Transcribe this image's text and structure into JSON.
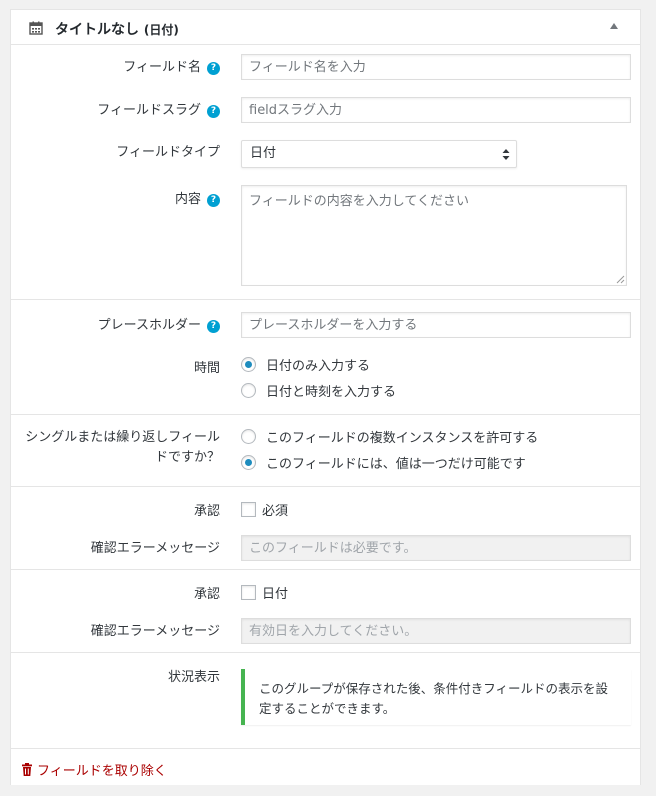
{
  "header": {
    "title": "タイトルなし",
    "type_label": "(日付)",
    "icon": "calendar-icon",
    "toggle_icon": "triangle-up-icon"
  },
  "fields": {
    "field_name": {
      "label": "フィールド名",
      "placeholder": "フィールド名を入力"
    },
    "field_slug": {
      "label": "フィールドスラグ",
      "placeholder": "fieldスラグ入力"
    },
    "field_type": {
      "label": "フィールドタイプ",
      "value": "日付"
    },
    "content": {
      "label": "内容",
      "placeholder": "フィールドの内容を入力してください"
    },
    "placeholder": {
      "label": "プレースホルダー",
      "placeholder": "プレースホルダーを入力する"
    },
    "time": {
      "label": "時間",
      "options": [
        "日付のみ入力する",
        "日付と時刻を入力する"
      ],
      "selected_index": 0
    },
    "repeat": {
      "label": "シングルまたは繰り返しフィールドですか？",
      "options": [
        "このフィールドの複数インスタンスを許可する",
        "このフィールドには、値は一つだけ可能です"
      ],
      "selected_index": 1
    },
    "validation_required": {
      "label": "承認",
      "checkbox_label": "必須",
      "error_label": "確認エラーメッセージ",
      "error_placeholder": "このフィールドは必要です。"
    },
    "validation_date": {
      "label": "承認",
      "checkbox_label": "日付",
      "error_label": "確認エラーメッセージ",
      "error_placeholder": "有効日を入力してください。"
    },
    "status": {
      "label": "状況表示",
      "notice": "このグループが保存された後、条件付きフィールドの表示を設定することができます。"
    }
  },
  "help_glyph": "?",
  "footer": {
    "remove_label": "フィールドを取り除く",
    "icon": "trash-icon"
  },
  "colors": {
    "accent": "#00a0d2",
    "radio": "#1e8cbe",
    "notice": "#46b450",
    "danger": "#aa0000"
  }
}
